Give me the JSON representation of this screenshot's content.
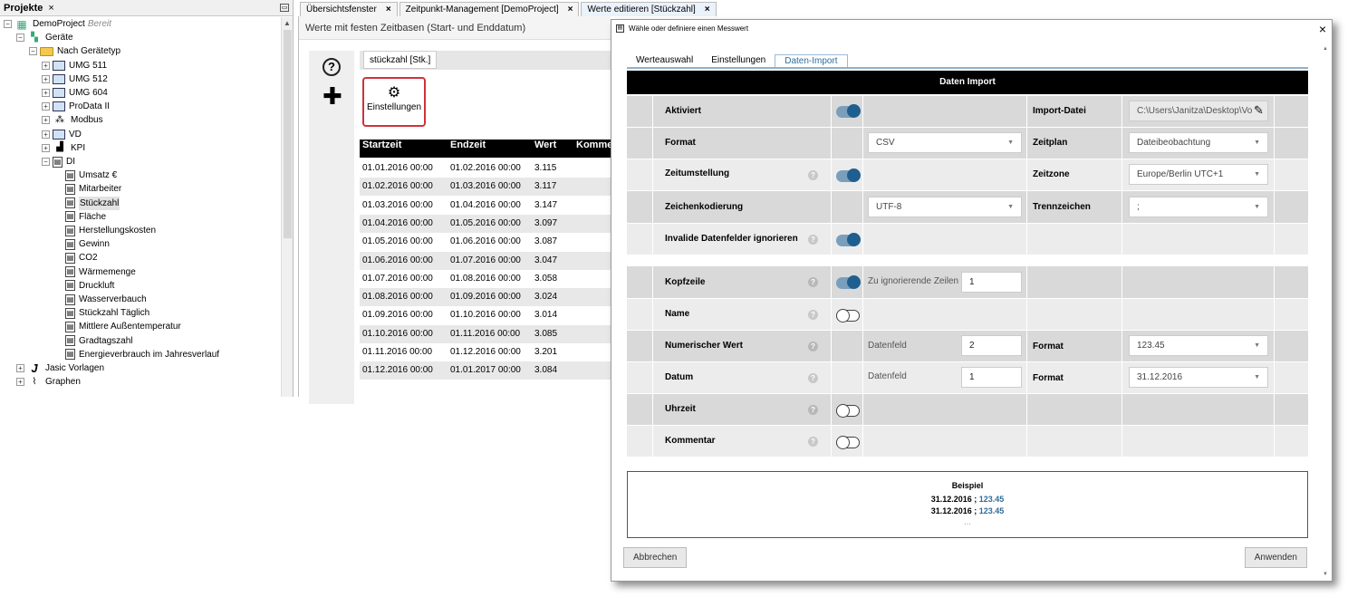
{
  "left_panel": {
    "title": "Projekte",
    "close": "×",
    "tree": [
      {
        "label": "DemoProject",
        "suffix": "Bereit",
        "level": 0,
        "icon": "project-icon"
      },
      {
        "label": "Geräte",
        "level": 1,
        "icon": "devices-icon"
      },
      {
        "label": "Nach Gerätetyp",
        "level": 2,
        "icon": "folder-icon"
      },
      {
        "label": "UMG 511",
        "level": 3,
        "icon": "device-icon"
      },
      {
        "label": "UMG 512",
        "level": 3,
        "icon": "device-icon"
      },
      {
        "label": "UMG 604",
        "level": 3,
        "icon": "device-icon"
      },
      {
        "label": "ProData II",
        "level": 3,
        "icon": "device-icon"
      },
      {
        "label": "Modbus",
        "level": 3,
        "icon": "modbus-icon"
      },
      {
        "label": "VD",
        "level": 3,
        "icon": "device-icon"
      },
      {
        "label": "KPI",
        "level": 3,
        "icon": "kpi-icon"
      },
      {
        "label": "DI",
        "level": 3,
        "icon": "di-icon"
      },
      {
        "label": "Umsatz €",
        "level": 4,
        "icon": "data-icon"
      },
      {
        "label": "Mitarbeiter",
        "level": 4,
        "icon": "data-icon"
      },
      {
        "label": "Stückzahl",
        "level": 4,
        "icon": "data-icon",
        "selected": true
      },
      {
        "label": "Fläche",
        "level": 4,
        "icon": "data-icon"
      },
      {
        "label": "Herstellungskosten",
        "level": 4,
        "icon": "data-icon"
      },
      {
        "label": "Gewinn",
        "level": 4,
        "icon": "data-icon"
      },
      {
        "label": "CO2",
        "level": 4,
        "icon": "data-icon"
      },
      {
        "label": "Wärmemenge",
        "level": 4,
        "icon": "data-icon"
      },
      {
        "label": "Druckluft",
        "level": 4,
        "icon": "data-icon"
      },
      {
        "label": "Wasserverbauch",
        "level": 4,
        "icon": "data-icon"
      },
      {
        "label": "Stückzahl Täglich",
        "level": 4,
        "icon": "data-icon"
      },
      {
        "label": "Mittlere Außentemperatur",
        "level": 4,
        "icon": "data-icon"
      },
      {
        "label": "Gradtagszahl",
        "level": 4,
        "icon": "data-icon"
      },
      {
        "label": "Energieverbrauch im Jahresverlauf",
        "level": 4,
        "icon": "data-icon"
      },
      {
        "label": "Jasic Vorlagen",
        "level": 1,
        "icon": "jasic-icon"
      },
      {
        "label": "Graphen",
        "level": 1,
        "icon": "graph-icon"
      }
    ]
  },
  "tabs": [
    {
      "label": "Übersichtsfenster",
      "close": "×"
    },
    {
      "label": "Zeitpunkt-Management [DemoProject]",
      "close": "×"
    },
    {
      "label": "Werte editieren [Stückzahl]",
      "close": "×"
    }
  ],
  "main": {
    "subtitle": "Werte mit festen Zeitbasen (Start- und Enddatum)",
    "subtab": "stückzahl [Stk.]",
    "settings_button": "Einstellungen",
    "table": {
      "headers": [
        "Startzeit",
        "Endzeit",
        "Wert",
        "Komme"
      ],
      "rows": [
        [
          "01.01.2016 00:00",
          "01.02.2016 00:00",
          "3.115"
        ],
        [
          "01.02.2016 00:00",
          "01.03.2016 00:00",
          "3.117"
        ],
        [
          "01.03.2016 00:00",
          "01.04.2016 00:00",
          "3.147"
        ],
        [
          "01.04.2016 00:00",
          "01.05.2016 00:00",
          "3.097"
        ],
        [
          "01.05.2016 00:00",
          "01.06.2016 00:00",
          "3.087"
        ],
        [
          "01.06.2016 00:00",
          "01.07.2016 00:00",
          "3.047"
        ],
        [
          "01.07.2016 00:00",
          "01.08.2016 00:00",
          "3.058"
        ],
        [
          "01.08.2016 00:00",
          "01.09.2016 00:00",
          "3.024"
        ],
        [
          "01.09.2016 00:00",
          "01.10.2016 00:00",
          "3.014"
        ],
        [
          "01.10.2016 00:00",
          "01.11.2016 00:00",
          "3.085"
        ],
        [
          "01.11.2016 00:00",
          "01.12.2016 00:00",
          "3.201"
        ],
        [
          "01.12.2016 00:00",
          "01.01.2017 00:00",
          "3.084"
        ]
      ]
    }
  },
  "dialog": {
    "title": "Wähle oder definiere einen Messwert",
    "close": "×",
    "tabs": [
      "Werteauswahl",
      "Einstellungen",
      "Daten-Import"
    ],
    "active_tab": "Daten-Import",
    "section_title": "Daten Import",
    "rows": {
      "aktiviert": {
        "label": "Aktiviert",
        "toggle": true
      },
      "import_datei": {
        "label": "Import-Datei",
        "value": "C:\\Users\\Janitza\\Desktop\\Vo"
      },
      "format": {
        "label": "Format",
        "value": "CSV"
      },
      "zeitplan": {
        "label": "Zeitplan",
        "value": "Dateibeobachtung"
      },
      "zeitumstellung": {
        "label": "Zeitumstellung",
        "toggle": true
      },
      "zeitzone": {
        "label": "Zeitzone",
        "value": "Europe/Berlin UTC+1"
      },
      "zeichenkodierung": {
        "label": "Zeichenkodierung",
        "value": "UTF-8"
      },
      "trennzeichen": {
        "label": "Trennzeichen",
        "value": ";"
      },
      "invalide": {
        "label": "Invalide Datenfelder ignorieren",
        "toggle": true
      },
      "kopfzeile": {
        "label": "Kopfzeile",
        "toggle": true,
        "sub_label": "Zu ignorierende Zeilen",
        "value": "1"
      },
      "name": {
        "label": "Name",
        "toggle": false
      },
      "numerischer_wert": {
        "label": "Numerischer Wert",
        "sub_label": "Datenfeld",
        "value": "2",
        "format_label": "Format",
        "format_value": "123.45"
      },
      "datum": {
        "label": "Datum",
        "sub_label": "Datenfeld",
        "value": "1",
        "format_label": "Format",
        "format_value": "31.12.2016"
      },
      "uhrzeit": {
        "label": "Uhrzeit",
        "toggle": false
      },
      "kommentar": {
        "label": "Kommentar",
        "toggle": false
      }
    },
    "example": {
      "title": "Beispiel",
      "lines": [
        {
          "date": "31.12.2016",
          "sep": " ; ",
          "value": "123.45"
        },
        {
          "date": "31.12.2016",
          "sep": " ; ",
          "value": "123.45"
        }
      ],
      "ellipsis": "..."
    },
    "cancel": "Abbrechen",
    "apply": "Anwenden"
  }
}
